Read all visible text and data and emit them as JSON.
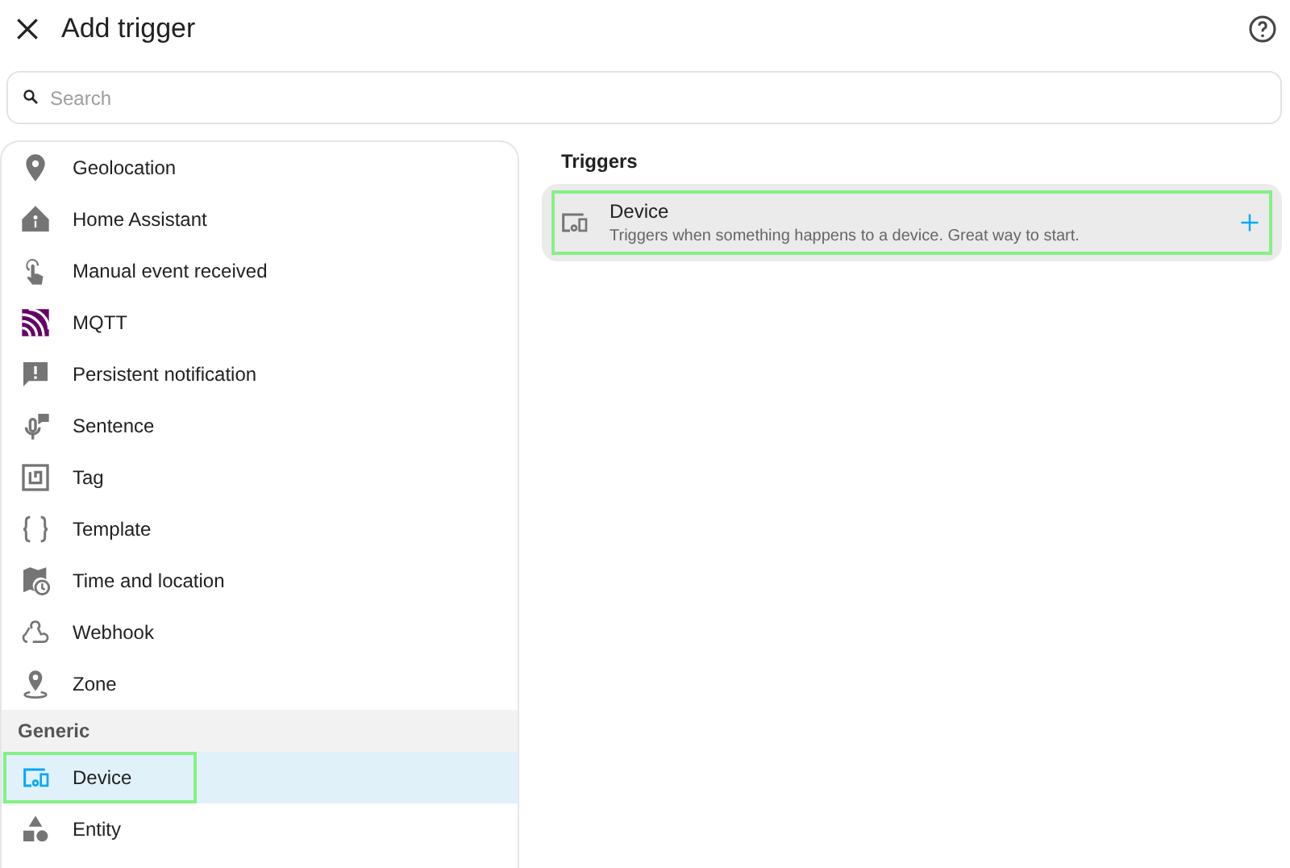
{
  "dialog": {
    "title": "Add trigger"
  },
  "search": {
    "placeholder": "Search"
  },
  "sidebar": {
    "items": [
      {
        "label": "Geolocation",
        "selected": false,
        "highlighted": false
      },
      {
        "label": "Home Assistant",
        "selected": false,
        "highlighted": false
      },
      {
        "label": "Manual event received",
        "selected": false,
        "highlighted": false
      },
      {
        "label": "MQTT",
        "selected": false,
        "highlighted": false
      },
      {
        "label": "Persistent notification",
        "selected": false,
        "highlighted": false
      },
      {
        "label": "Sentence",
        "selected": false,
        "highlighted": false
      },
      {
        "label": "Tag",
        "selected": false,
        "highlighted": false
      },
      {
        "label": "Template",
        "selected": false,
        "highlighted": false
      },
      {
        "label": "Time and location",
        "selected": false,
        "highlighted": false
      },
      {
        "label": "Webhook",
        "selected": false,
        "highlighted": false
      },
      {
        "label": "Zone",
        "selected": false,
        "highlighted": false
      }
    ],
    "groups": [
      {
        "title": "Generic",
        "items": [
          {
            "label": "Device",
            "selected": true,
            "highlighted": true
          },
          {
            "label": "Entity",
            "selected": false,
            "highlighted": false
          }
        ]
      }
    ]
  },
  "triggers": {
    "title": "Triggers",
    "items": [
      {
        "name": "Device",
        "description": "Triggers when something happens to a device. Great way to start.",
        "highlighted": true
      }
    ]
  }
}
